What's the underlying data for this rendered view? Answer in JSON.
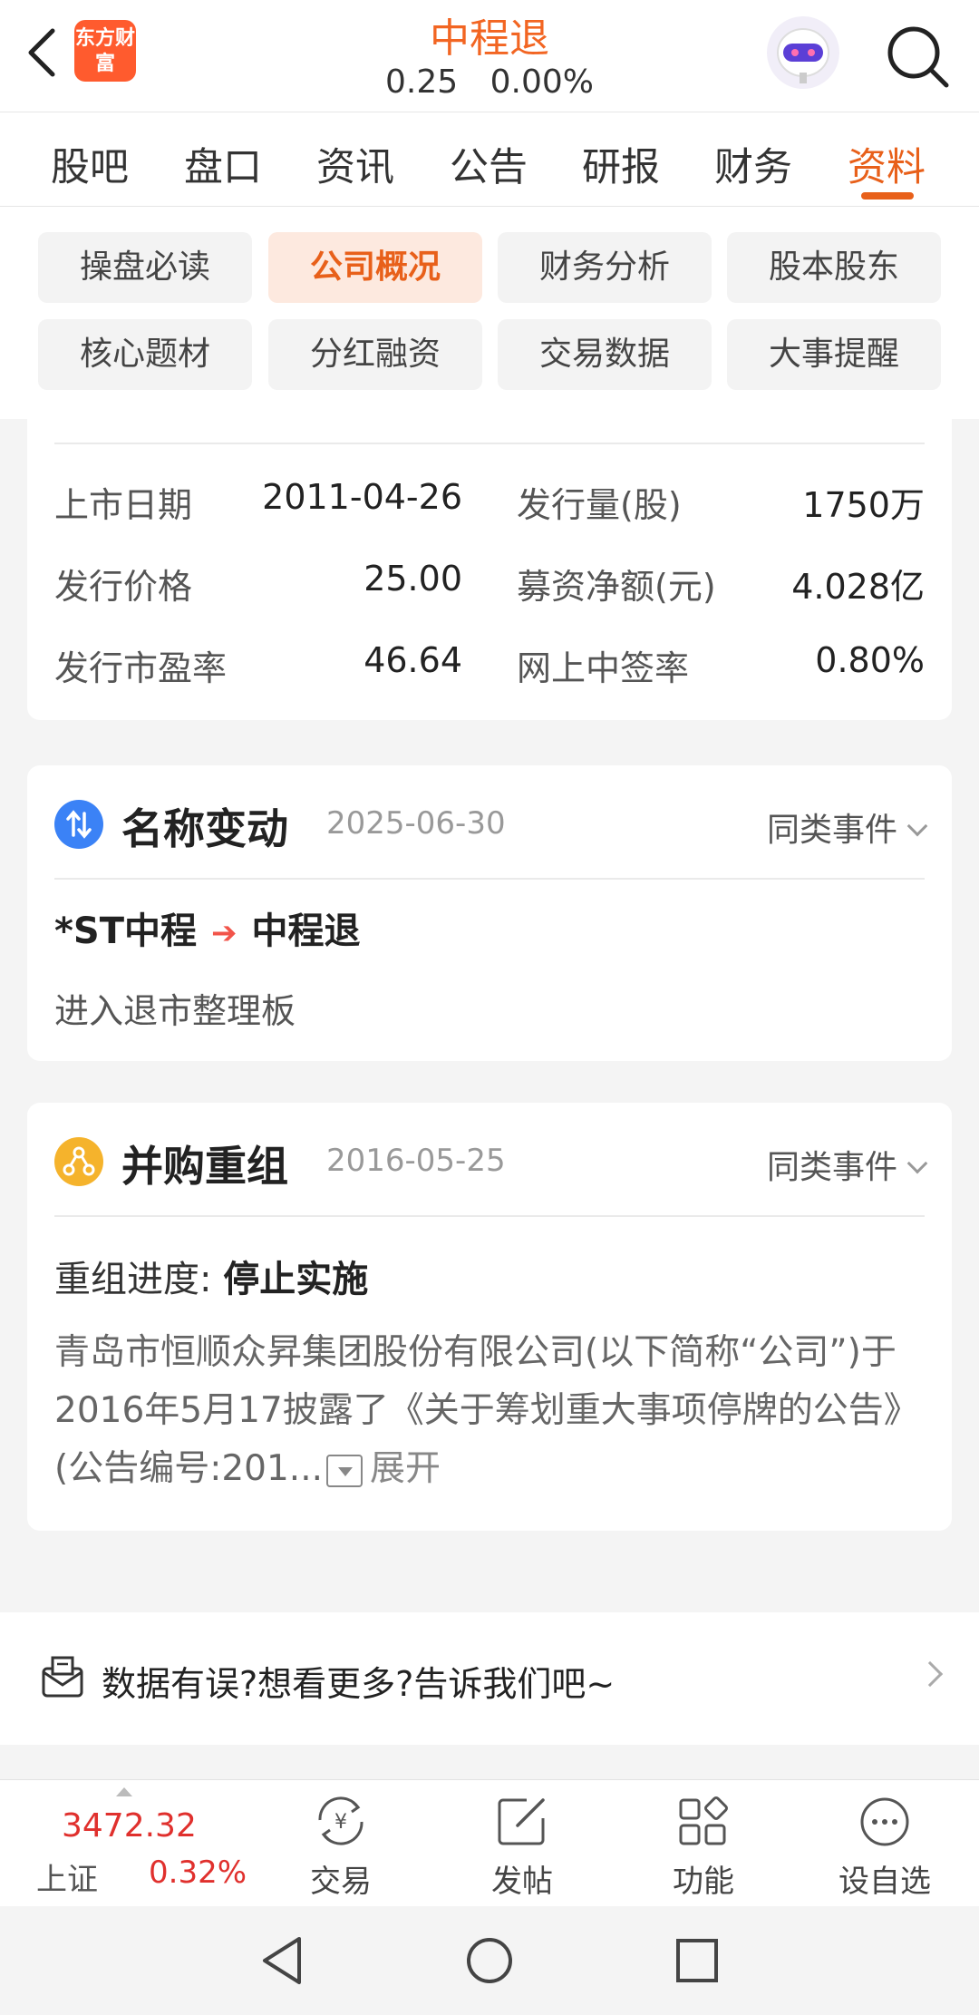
{
  "header": {
    "logo_text": "东方财富",
    "title": "中程退",
    "price": "0.25",
    "change": "0.00%"
  },
  "tabs": [
    {
      "label": "股吧"
    },
    {
      "label": "盘口"
    },
    {
      "label": "资讯"
    },
    {
      "label": "公告"
    },
    {
      "label": "研报"
    },
    {
      "label": "财务"
    },
    {
      "label": "资料",
      "active": true
    }
  ],
  "chips": [
    {
      "label": "操盘必读"
    },
    {
      "label": "公司概况",
      "active": true
    },
    {
      "label": "财务分析"
    },
    {
      "label": "股本股东"
    },
    {
      "label": "核心题材"
    },
    {
      "label": "分红融资"
    },
    {
      "label": "交易数据"
    },
    {
      "label": "大事提醒"
    }
  ],
  "issue_info": [
    {
      "label": "上市日期",
      "value": "2011-04-26",
      "label2": "发行量(股)",
      "value2": "1750万"
    },
    {
      "label": "发行价格",
      "value": "25.00",
      "label2": "募资净额(元)",
      "value2": "4.028亿"
    },
    {
      "label": "发行市盈率",
      "value": "46.64",
      "label2": "网上中签率",
      "value2": "0.80%"
    }
  ],
  "rename_event": {
    "title": "名称变动",
    "date": "2025-06-30",
    "link": "同类事件",
    "old_name": "*ST中程",
    "new_name": "中程退",
    "note": "进入退市整理板",
    "icon": "swap-icon",
    "icon_color": "#3b82f6"
  },
  "merge_event": {
    "title": "并购重组",
    "date": "2016-05-25",
    "link": "同类事件",
    "progress_label": "重组进度:",
    "progress_value": "停止实施",
    "description": "青岛市恒顺众昇集团股份有限公司(以下简称“公司”)于2016年5月17披露了《关于筹划重大事项停牌的公告》(公告编号:201...",
    "expand": "展开",
    "icon": "network-icon",
    "icon_color": "#f5b32c"
  },
  "feedback": {
    "text": "数据有误?想看更多?告诉我们吧~"
  },
  "toolbar": {
    "index_value": "3472.32",
    "index_name": "上证",
    "index_pct": "0.32%",
    "items": [
      {
        "label": "交易",
        "icon": "trade-icon"
      },
      {
        "label": "发帖",
        "icon": "compose-icon"
      },
      {
        "label": "功能",
        "icon": "grid-icon"
      },
      {
        "label": "设自选",
        "icon": "more-icon"
      }
    ]
  },
  "colors": {
    "accent": "#e8601a",
    "up_red": "#e0302d"
  }
}
